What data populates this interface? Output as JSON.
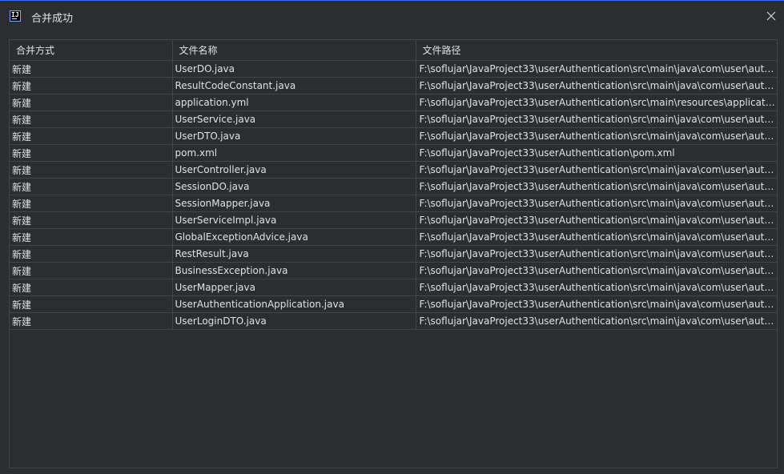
{
  "window": {
    "title": "合并成功",
    "app_icon": "intellij-idea-icon",
    "close_icon": "close-icon"
  },
  "table": {
    "columns": [
      "合并方式",
      "文件名称",
      "文件路径"
    ],
    "rows": [
      {
        "mode": "新建",
        "name": "UserDO.java",
        "path": "F:\\soflujar\\JavaProject33\\userAuthentication\\src\\main\\java\\com\\user\\authe…"
      },
      {
        "mode": "新建",
        "name": "ResultCodeConstant.java",
        "path": "F:\\soflujar\\JavaProject33\\userAuthentication\\src\\main\\java\\com\\user\\authe…"
      },
      {
        "mode": "新建",
        "name": "application.yml",
        "path": "F:\\soflujar\\JavaProject33\\userAuthentication\\src\\main\\resources\\applicatio…"
      },
      {
        "mode": "新建",
        "name": "UserService.java",
        "path": "F:\\soflujar\\JavaProject33\\userAuthentication\\src\\main\\java\\com\\user\\authe…"
      },
      {
        "mode": "新建",
        "name": "UserDTO.java",
        "path": "F:\\soflujar\\JavaProject33\\userAuthentication\\src\\main\\java\\com\\user\\authe…"
      },
      {
        "mode": "新建",
        "name": "pom.xml",
        "path": "F:\\soflujar\\JavaProject33\\userAuthentication\\pom.xml"
      },
      {
        "mode": "新建",
        "name": "UserController.java",
        "path": "F:\\soflujar\\JavaProject33\\userAuthentication\\src\\main\\java\\com\\user\\authe…"
      },
      {
        "mode": "新建",
        "name": "SessionDO.java",
        "path": "F:\\soflujar\\JavaProject33\\userAuthentication\\src\\main\\java\\com\\user\\authe…"
      },
      {
        "mode": "新建",
        "name": "SessionMapper.java",
        "path": "F:\\soflujar\\JavaProject33\\userAuthentication\\src\\main\\java\\com\\user\\authe…"
      },
      {
        "mode": "新建",
        "name": "UserServiceImpl.java",
        "path": "F:\\soflujar\\JavaProject33\\userAuthentication\\src\\main\\java\\com\\user\\authe…"
      },
      {
        "mode": "新建",
        "name": "GlobalExceptionAdvice.java",
        "path": "F:\\soflujar\\JavaProject33\\userAuthentication\\src\\main\\java\\com\\user\\authe…"
      },
      {
        "mode": "新建",
        "name": "RestResult.java",
        "path": "F:\\soflujar\\JavaProject33\\userAuthentication\\src\\main\\java\\com\\user\\authe…"
      },
      {
        "mode": "新建",
        "name": "BusinessException.java",
        "path": "F:\\soflujar\\JavaProject33\\userAuthentication\\src\\main\\java\\com\\user\\authe…"
      },
      {
        "mode": "新建",
        "name": "UserMapper.java",
        "path": "F:\\soflujar\\JavaProject33\\userAuthentication\\src\\main\\java\\com\\user\\authe…"
      },
      {
        "mode": "新建",
        "name": "UserAuthenticationApplication.java",
        "path": "F:\\soflujar\\JavaProject33\\userAuthentication\\src\\main\\java\\com\\user\\authe…"
      },
      {
        "mode": "新建",
        "name": "UserLoginDTO.java",
        "path": "F:\\soflujar\\JavaProject33\\userAuthentication\\src\\main\\java\\com\\user\\authe…"
      }
    ]
  }
}
